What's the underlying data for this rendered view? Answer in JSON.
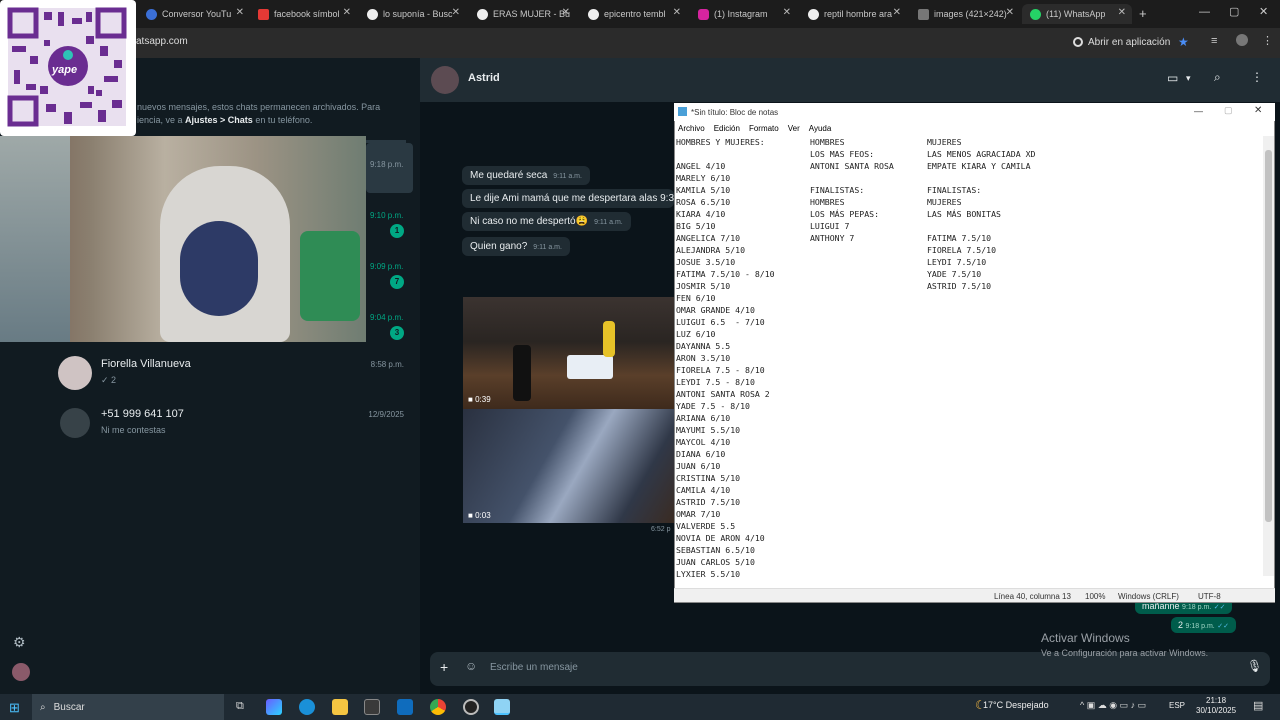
{
  "browser": {
    "tabs": [
      {
        "label": "Conversor YouTu"
      },
      {
        "label": "facebook símbol"
      },
      {
        "label": "lo suponía - Busc"
      },
      {
        "label": "ERAS MUJER - Bu"
      },
      {
        "label": "epicentro tembl"
      },
      {
        "label": "(1) Instagram"
      },
      {
        "label": "reptil hombre ara"
      },
      {
        "label": "images (421×242)"
      },
      {
        "label": "(11) WhatsApp"
      }
    ],
    "url": "atsapp.com",
    "open_in_app": "Abrir en aplicación"
  },
  "overlay": {
    "qr_brand": "yape"
  },
  "whatsapp": {
    "archive_notice_1": "nuevos mensajes, estos chats permanecen archivados. Para",
    "archive_notice_2a": "iencia, ve a ",
    "archive_notice_bold": "Ajustes > Chats",
    "archive_notice_2b": " en tu teléfono.",
    "side_times": [
      {
        "time": "9:18 p.m.",
        "badge": ""
      },
      {
        "time": "9:10 p.m.",
        "badge": "1"
      },
      {
        "time": "9:09 p.m.",
        "badge": "7"
      },
      {
        "time": "9:04 p.m.",
        "badge": "3"
      }
    ],
    "chats": [
      {
        "name": "Fiorella Villanueva",
        "preview": "✓ 2",
        "time": "8:58 p.m."
      },
      {
        "name": "+51 999 641 107",
        "preview": "Ni me contestas",
        "time": "12/9/2025"
      }
    ],
    "contact_name": "Astrid",
    "messages": [
      {
        "text": "Me quedaré seca",
        "time": "9:11 a.m."
      },
      {
        "text": "Le dije Ami mamá que me despertara alas 9:30",
        "time": ""
      },
      {
        "text": "Ni caso no me despertó😩",
        "time": "9:11 a.m."
      },
      {
        "text": "Quien gano?",
        "time": "9:11 a.m."
      }
    ],
    "video1_duration": "0:39",
    "video2_duration": "0:03",
    "video_time": "6:52 p",
    "out_msgs": [
      {
        "text": "mañanne",
        "time": "9:18 p.m."
      },
      {
        "text": "2",
        "time": "9:18 p.m."
      }
    ],
    "compose_placeholder": "Escribe un mensaje"
  },
  "notepad": {
    "title": "*Sin título: Bloc de notas",
    "menu": [
      "Archivo",
      "Edición",
      "Formato",
      "Ver",
      "Ayuda"
    ],
    "col1": "HOMBRES Y MUJERES:\n\nANGEL 4/10\nMARELY 6/10\nKAMILA 5/10\nROSA 6.5/10\nKIARA 4/10\nBIG 5/10\nANGELICA 7/10\nALEJANDRA 5/10\nJOSUE 3.5/10\nFATIMA 7.5/10 - 8/10\nJOSMIR 5/10\nFEN 6/10\nOMAR GRANDE 4/10\nLUIGUI 6.5  - 7/10\nLUZ 6/10\nDAYANNA 5.5\nARON 3.5/10\nFIORELA 7.5 - 8/10\nLEYDI 7.5 - 8/10\nANTONI SANTA ROSA 2\nYADE 7.5 - 8/10\nARIANA 6/10\nMAYUMI 5.5/10\nMAYCOL 4/10\nDIANA 6/10\nJUAN 6/10\nCRISTINA 5/10\nCAMILA 4/10\nASTRID 7.5/10\nOMAR 7/10\nVALVERDE 5.5\nNOVIA DE ARON 4/10\nSEBASTIAN 6.5/10\nJUAN CARLOS 5/10\nLYXIER 5.5/10",
    "col2": "HOMBRES\nLOS MAS FEOS:\nANTONI SANTA ROSA\n\nFINALISTAS:\nHOMBRES\nLOS MÁS PEPAS:\nLUIGUI 7\nANTHONY 7",
    "col3": "MUJERES\nLAS MENOS AGRACIADA XD\nEMPATE KIARA Y CAMILA\n\nFINALISTAS:\nMUJERES\nLAS MÁS BONITAS\n\nFATIMA 7.5/10\nFIORELA 7.5/10\nLEYDI 7.5/10\nYADE 7.5/10\nASTRID 7.5/10",
    "status_pos": "Línea 40, columna 13",
    "status_zoom": "100%",
    "status_eol": "Windows (CRLF)",
    "status_enc": "UTF-8"
  },
  "activate_windows": {
    "title": "Activar Windows",
    "subtitle": "Ve a Configuración para activar Windows."
  },
  "taskbar": {
    "search": "Buscar",
    "weather": "17°C  Despejado",
    "lang": "ESP",
    "time": "21:18",
    "date": "30/10/2025"
  },
  "colors": {
    "wa_green": "#00a884",
    "out_bubble": "#005c4b"
  }
}
